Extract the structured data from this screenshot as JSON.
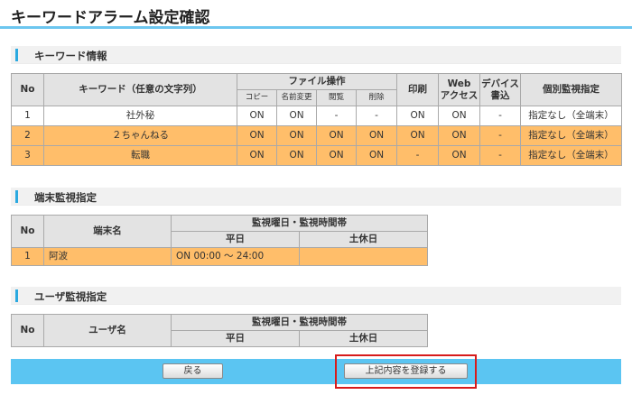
{
  "page_title": "キーワードアラーム設定確認",
  "keyword_section": {
    "title": "キーワード情報",
    "headers": {
      "no": "No",
      "keyword": "キーワード（任意の文字列）",
      "file_ops": "ファイル操作",
      "copy": "コピー",
      "rename": "名前変更",
      "view": "閲覧",
      "delete": "削除",
      "print": "印刷",
      "web_line1": "Web",
      "web_line2": "アクセス",
      "device_line1": "デバイス",
      "device_line2": "書込",
      "individual": "個別監視指定"
    },
    "rows": [
      {
        "no": "1",
        "keyword": "社外秘",
        "copy": "ON",
        "rename": "ON",
        "view": "-",
        "delete": "-",
        "print": "ON",
        "web": "ON",
        "device": "-",
        "individual": "指定なし（全端末）"
      },
      {
        "no": "2",
        "keyword": "２ちゃんねる",
        "copy": "ON",
        "rename": "ON",
        "view": "ON",
        "delete": "ON",
        "print": "ON",
        "web": "ON",
        "device": "-",
        "individual": "指定なし（全端末）"
      },
      {
        "no": "3",
        "keyword": "転職",
        "copy": "ON",
        "rename": "ON",
        "view": "ON",
        "delete": "ON",
        "print": "-",
        "web": "ON",
        "device": "-",
        "individual": "指定なし（全端末）"
      }
    ]
  },
  "terminal_section": {
    "title": "端末監視指定",
    "headers": {
      "no": "No",
      "name": "端末名",
      "schedule": "監視曜日・監視時間帯",
      "weekday": "平日",
      "weekend": "土休日"
    },
    "rows": [
      {
        "no": "1",
        "name": "阿波",
        "weekday": "ON  00:00 ～ 24:00",
        "weekend": ""
      }
    ]
  },
  "user_section": {
    "title": "ユーザ監視指定",
    "headers": {
      "no": "No",
      "name": "ユーザ名",
      "schedule": "監視曜日・監視時間帯",
      "weekday": "平日",
      "weekend": "土休日"
    }
  },
  "footer": {
    "back_label": "戻る",
    "register_label": "上記内容を登録する"
  },
  "colors": {
    "accent": "#5bc5f2",
    "highlight_row": "#ffbe6a",
    "header_cell": "#e3e3e3",
    "focus_outline": "#d71b1b"
  }
}
